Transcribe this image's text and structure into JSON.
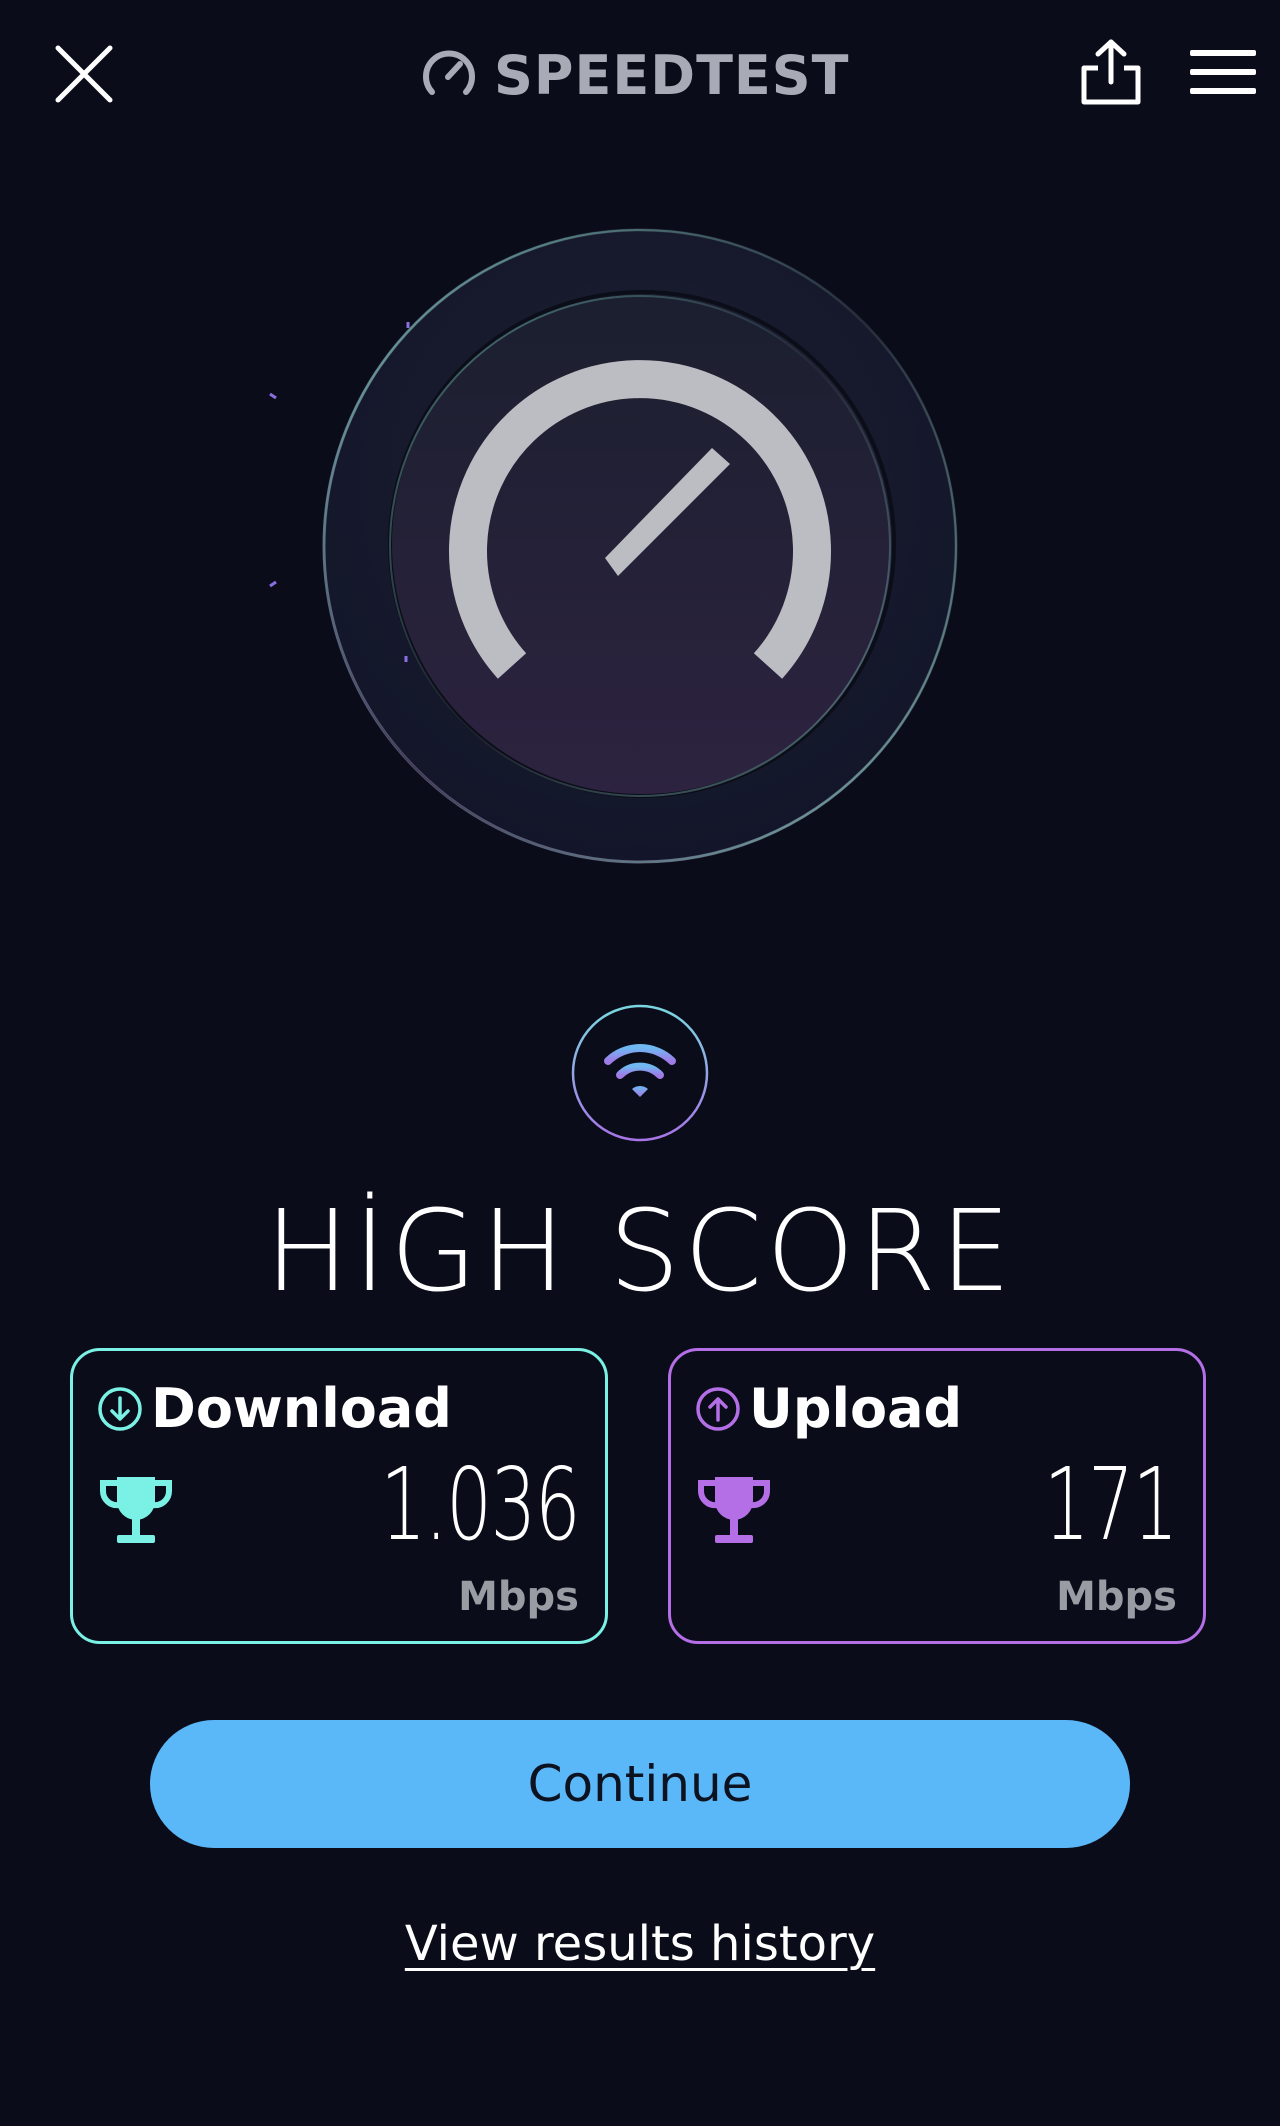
{
  "header": {
    "brand": "SPEEDTEST",
    "close_icon": "close-icon",
    "share_icon": "share-icon",
    "menu_icon": "hamburger-menu-icon",
    "brand_icon": "speedometer-icon"
  },
  "gauge": {
    "icon": "speedometer-gauge"
  },
  "connection": {
    "icon": "wifi-icon"
  },
  "title": "HİGH SCORE",
  "download": {
    "label": "Download",
    "value": "1.036",
    "unit": "Mbps",
    "color": "#7af1e4",
    "icon": "download-arrow-icon",
    "badge_icon": "trophy-icon"
  },
  "upload": {
    "label": "Upload",
    "value": "171",
    "unit": "Mbps",
    "color": "#b46ee6",
    "icon": "upload-arrow-icon",
    "badge_icon": "trophy-icon"
  },
  "actions": {
    "continue_label": "Continue",
    "history_label": "View results history"
  },
  "colors": {
    "background": "#0a0d19",
    "accent_blue": "#5ab8f8",
    "download": "#7af1e4",
    "upload": "#b46ee6",
    "muted_text": "#9a9ca4"
  }
}
